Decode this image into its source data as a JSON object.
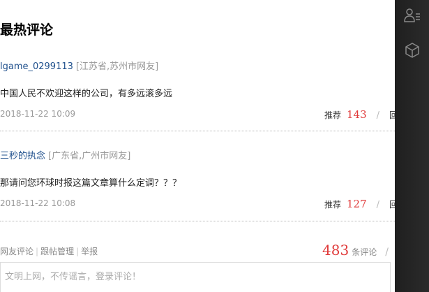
{
  "section": {
    "title": "最热评论"
  },
  "comments": [
    {
      "username": "lgame_0299113",
      "location": "[江苏省,苏州市网友]",
      "text": "中国人民不欢迎这样的公司，有多远滚多远",
      "time": "2018-11-22 10:09",
      "recommend_label": "推荐",
      "recommend_count": "143",
      "separator": "/",
      "reply_label": "回复"
    },
    {
      "username": "三秒的执念",
      "location": "[广东省,广州市网友]",
      "text": "那请问您环球时报这篇文章算什么定调？？？",
      "time": "2018-11-22 10:08",
      "recommend_label": "推荐",
      "recommend_count": "127",
      "separator": "/",
      "reply_label": "回复"
    }
  ],
  "footer": {
    "links": [
      "网友评论",
      "跟帖管理",
      "举报"
    ],
    "link_separator": "|",
    "comment_count": "483",
    "comment_count_label": "条评论",
    "separator": "/"
  },
  "comment_input": {
    "placeholder": "文明上网，不传谣言，登录评论！"
  },
  "side_rail": {
    "icons": [
      "user-list-icon",
      "cube-icon"
    ]
  },
  "colors": {
    "username": "#1e4f8c",
    "muted": "#999999",
    "accent_red": "#e03b3b",
    "rail_background": "#252525"
  }
}
